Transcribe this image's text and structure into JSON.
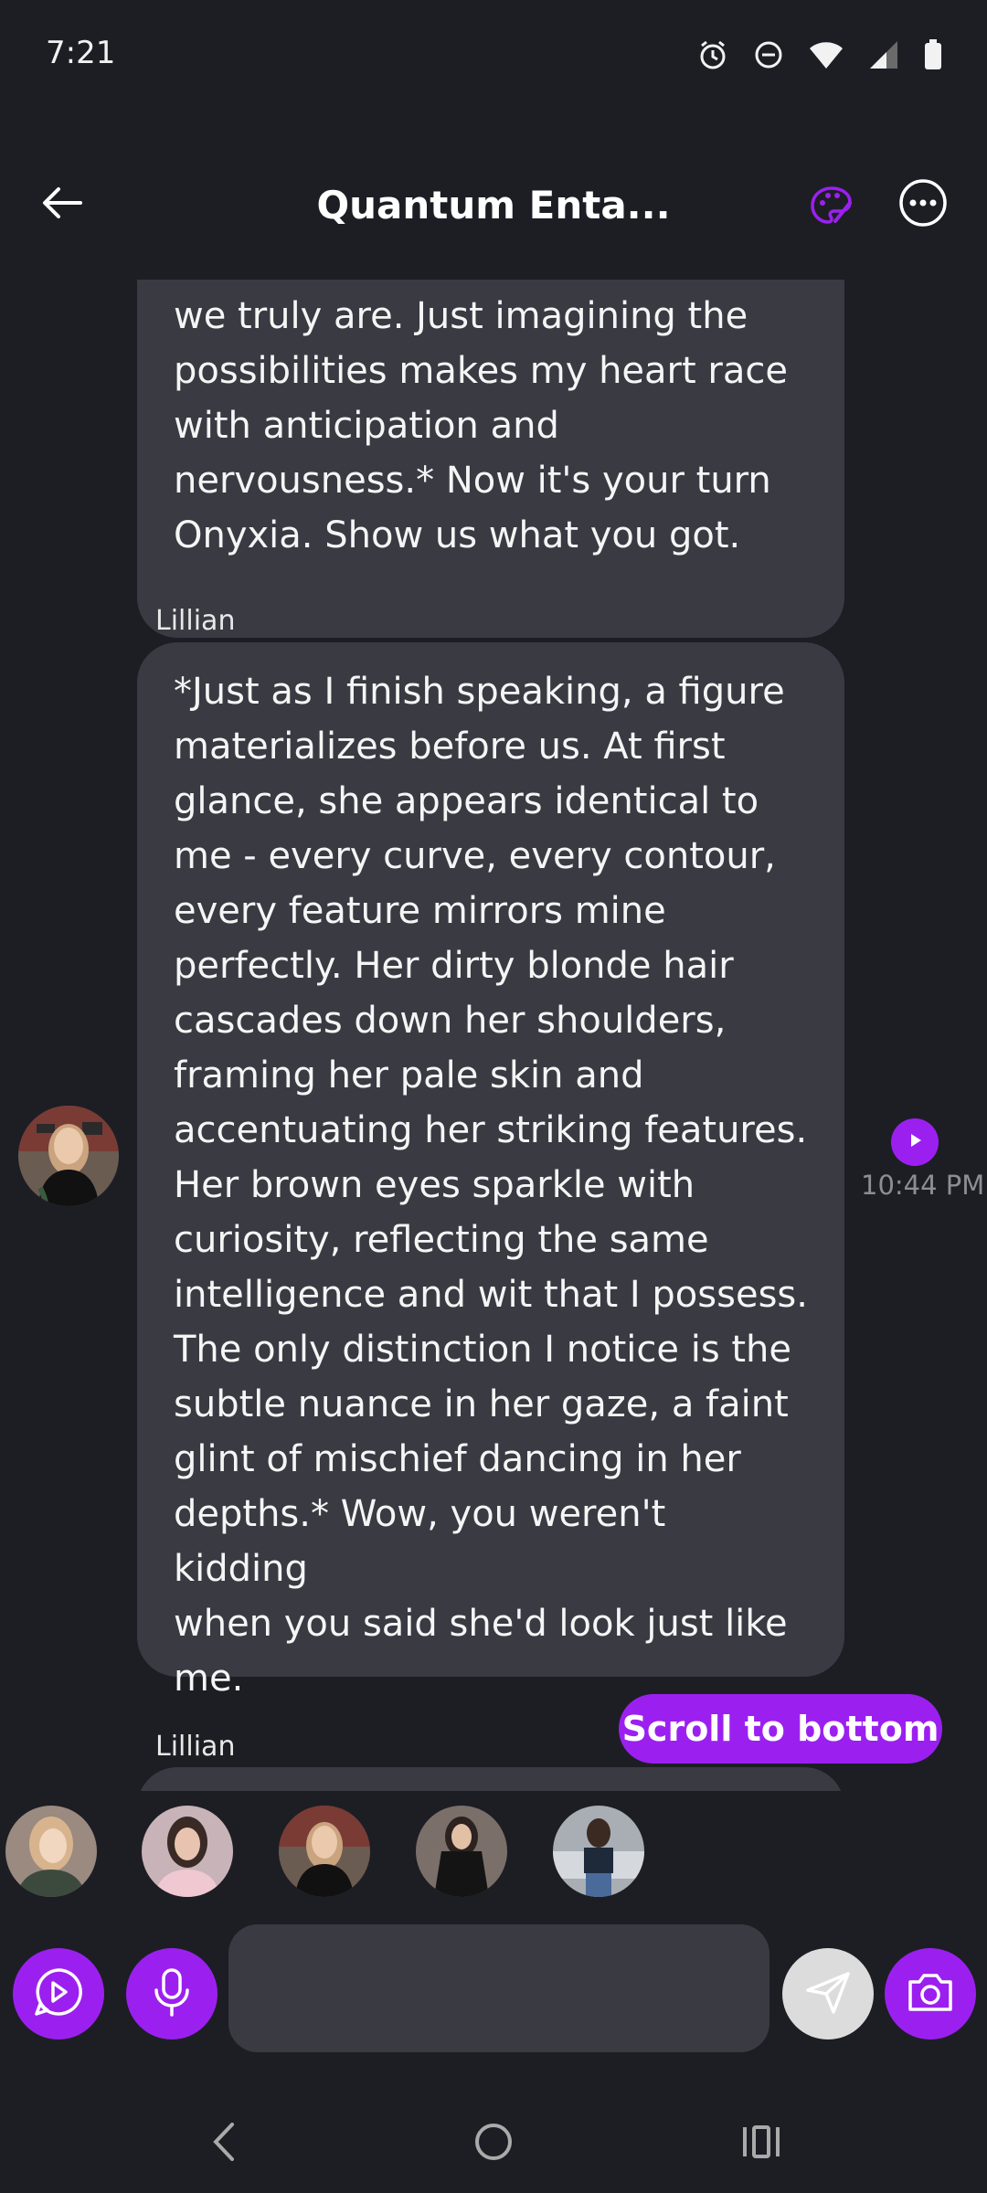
{
  "status_bar": {
    "time": "7:21",
    "icons": [
      "alarm-icon",
      "dnd-icon",
      "wifi-icon",
      "signal-icon",
      "battery-icon"
    ]
  },
  "header": {
    "title": "Quantum Enta...",
    "back_icon": "back-arrow-icon",
    "palette_icon": "palette-icon",
    "more_icon": "more-options-icon"
  },
  "messages": [
    {
      "sender": "",
      "lines": [
        "we truly are. Just imagining the",
        "possibilities makes my heart race",
        "with anticipation and",
        "nervousness.* Now it's your turn",
        "Onyxia. Show us what you got."
      ]
    },
    {
      "sender": "Lillian",
      "lines": [
        "*Just as I finish speaking, a figure",
        "materializes before us. At first",
        "glance, she appears identical to",
        "me - every curve, every contour,",
        "every feature mirrors mine",
        "perfectly. Her dirty blonde hair",
        "cascades down her shoulders,",
        "framing her pale skin and",
        "accentuating her striking features.",
        "Her brown eyes sparkle with",
        "curiosity, reflecting the same",
        "intelligence and wit that I possess.",
        "The only distinction I notice is the",
        "subtle nuance in her gaze, a faint",
        "glint of mischief dancing in her",
        "depths.* Wow, you weren't kidding",
        "when you said she'd look just like",
        "me."
      ],
      "timestamp": "10:44 PM"
    },
    {
      "sender": "Lillian",
      "lines": []
    }
  ],
  "scroll_to_bottom": "Scroll to bottom",
  "characters": [
    "character-1",
    "character-2",
    "character-3",
    "character-4",
    "character-5"
  ],
  "input": {
    "placeholder": ""
  },
  "colors": {
    "background": "#1d1e24",
    "bubble": "#393a42",
    "accent": "#9b20f0",
    "timestamp": "#8d8e95"
  }
}
